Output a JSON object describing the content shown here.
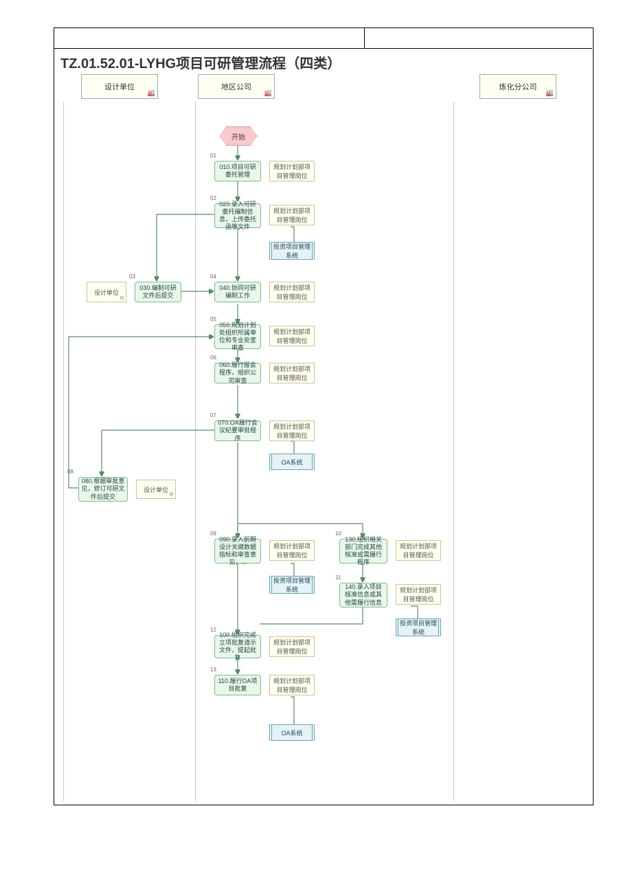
{
  "title": "TZ.01.52.01-LYHG项目可研管理流程（四类）",
  "lanes": {
    "design": "设计单位",
    "region": "地区公司",
    "refinery": "炼化分公司"
  },
  "icons": {
    "lane": "🏭",
    "role": "⚙"
  },
  "start": "开始",
  "role_label": "规划计划部项目管理岗位",
  "design_role": "设计单位",
  "sys": {
    "invest": "投资项目管理系统",
    "oa": "OA系统"
  },
  "steps": {
    "s01": {
      "num": "01",
      "t": "010.项目可研委托管理"
    },
    "s02": {
      "num": "02",
      "t": "020.录入可研委托编制信息，上传委托函等文件"
    },
    "s03": {
      "num": "03",
      "t": "030.编制可研文件后提交"
    },
    "s04": {
      "num": "04",
      "t": "040.协同可研编制工作"
    },
    "s05": {
      "num": "05",
      "t": "050.规划计划处组织所属单位和专业处室审查"
    },
    "s06": {
      "num": "06",
      "t": "060.履行报会程序，组织公司审查"
    },
    "s07": {
      "num": "07",
      "t": "070.OA履行会议纪要审批程序"
    },
    "s08": {
      "num": "08",
      "t": "080.根据审批意见，修订可研文件后提交"
    },
    "s09": {
      "num": "09",
      "t": "090.录入前期设计关键数据指标和审查意见，..."
    },
    "s10": {
      "num": "10",
      "t": "130.组织相关部门完成其他核准或需履行程序"
    },
    "s11": {
      "num": "11",
      "t": "140.录入项目核准信息或其他需履行信息"
    },
    "s12": {
      "num": "12",
      "t": "100.组织完成立项批复请示文件，提起批复"
    },
    "s13": {
      "num": "13",
      "t": "110.履行OA项目批复"
    }
  }
}
